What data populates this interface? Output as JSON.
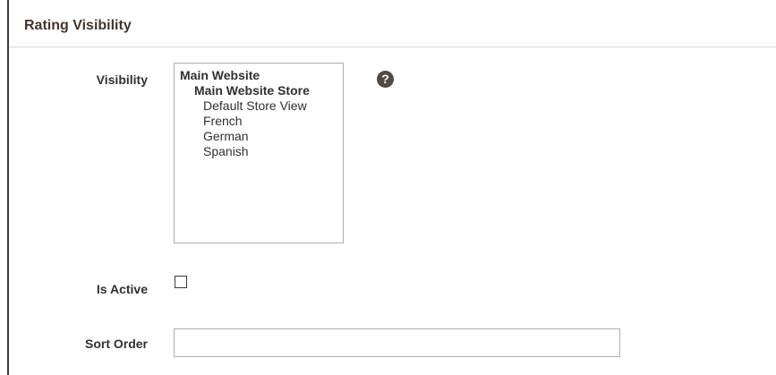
{
  "section": {
    "title": "Rating Visibility"
  },
  "fields": {
    "visibility": {
      "label": "Visibility",
      "options": {
        "website": "Main Website",
        "store": "Main Website Store",
        "views": [
          "Default Store View",
          "French",
          "German",
          "Spanish"
        ]
      },
      "help_icon": "question-mark-icon",
      "help_glyph": "?"
    },
    "is_active": {
      "label": "Is Active",
      "checked": false
    },
    "sort_order": {
      "label": "Sort Order",
      "value": "",
      "placeholder": ""
    }
  },
  "colors": {
    "title": "#41362f",
    "help_icon_bg": "#514943",
    "input_border": "#adadad",
    "divider": "#d6d6d6"
  }
}
